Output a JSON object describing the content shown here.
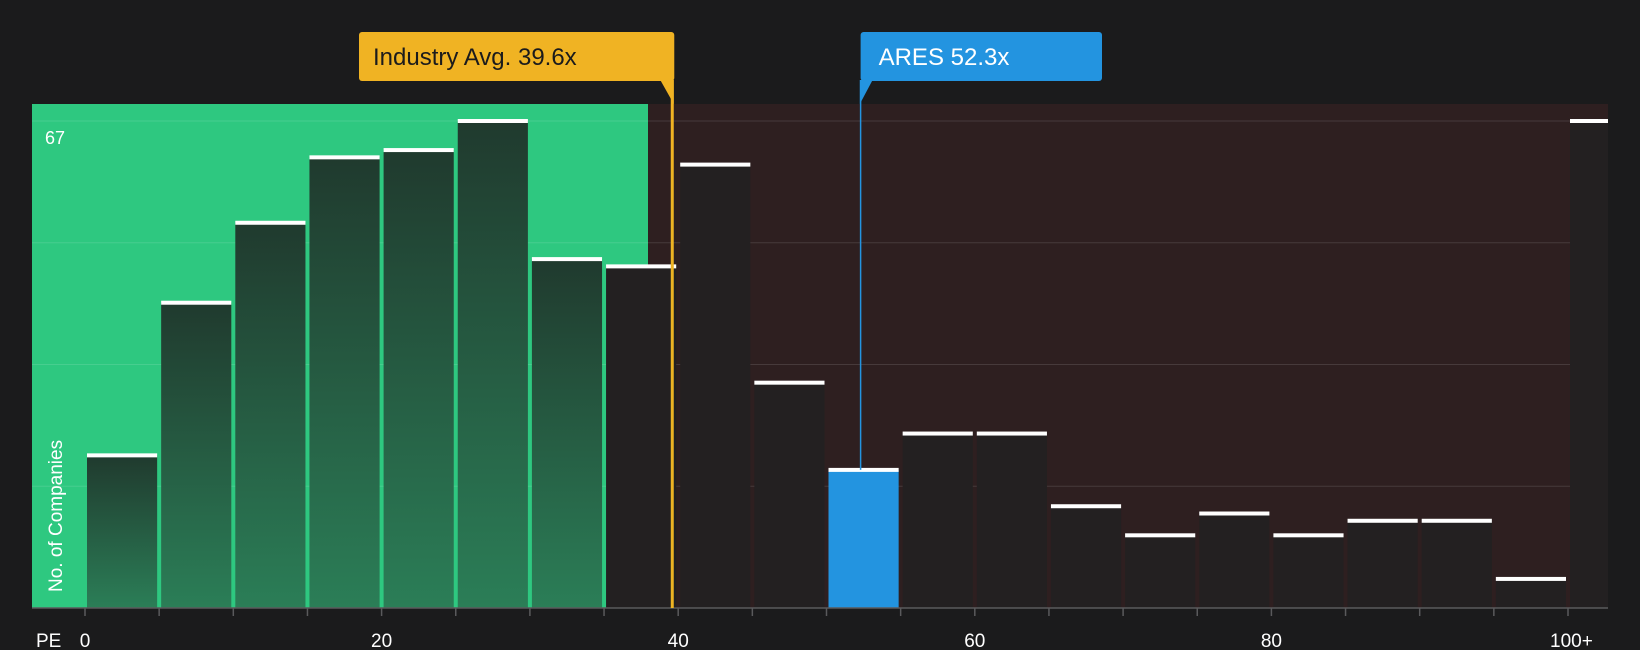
{
  "chart_data": {
    "type": "bar",
    "xlabel": "PE",
    "ylabel": "No. of Companies",
    "y_max_label": "67",
    "ylim": [
      0,
      67
    ],
    "x_ticks": [
      "0",
      "20",
      "40",
      "60",
      "80",
      "100+"
    ],
    "bins": [
      {
        "range": "0-5",
        "value": 21
      },
      {
        "range": "5-10",
        "value": 42
      },
      {
        "range": "10-15",
        "value": 53
      },
      {
        "range": "15-20",
        "value": 62
      },
      {
        "range": "20-25",
        "value": 63
      },
      {
        "range": "25-30",
        "value": 67
      },
      {
        "range": "30-35",
        "value": 48
      },
      {
        "range": "35-40",
        "value": 47
      },
      {
        "range": "40-45",
        "value": 61
      },
      {
        "range": "45-50",
        "value": 31
      },
      {
        "range": "50-55",
        "value": 19
      },
      {
        "range": "55-60",
        "value": 24
      },
      {
        "range": "60-65",
        "value": 24
      },
      {
        "range": "65-70",
        "value": 14
      },
      {
        "range": "70-75",
        "value": 10
      },
      {
        "range": "75-80",
        "value": 13
      },
      {
        "range": "80-85",
        "value": 10
      },
      {
        "range": "85-90",
        "value": 12
      },
      {
        "range": "90-95",
        "value": 12
      },
      {
        "range": "95-100",
        "value": 4
      },
      {
        "range": "100+",
        "value": 67
      }
    ],
    "highlight_bin": "50-55",
    "industry_avg": {
      "label": "Industry Avg. 39.6x",
      "value": 39.6,
      "color": "#f0b323"
    },
    "company": {
      "label": "ARES 52.3x",
      "value": 52.3,
      "color": "#2394e0"
    },
    "colors": {
      "background": "#1b1b1c",
      "good_zone": "#2ec880",
      "bad_zone": "#2e1f20",
      "bar_dark": "#213028",
      "bar_in_bad_zone": "#232021",
      "bar_top": "#ffffff"
    }
  }
}
